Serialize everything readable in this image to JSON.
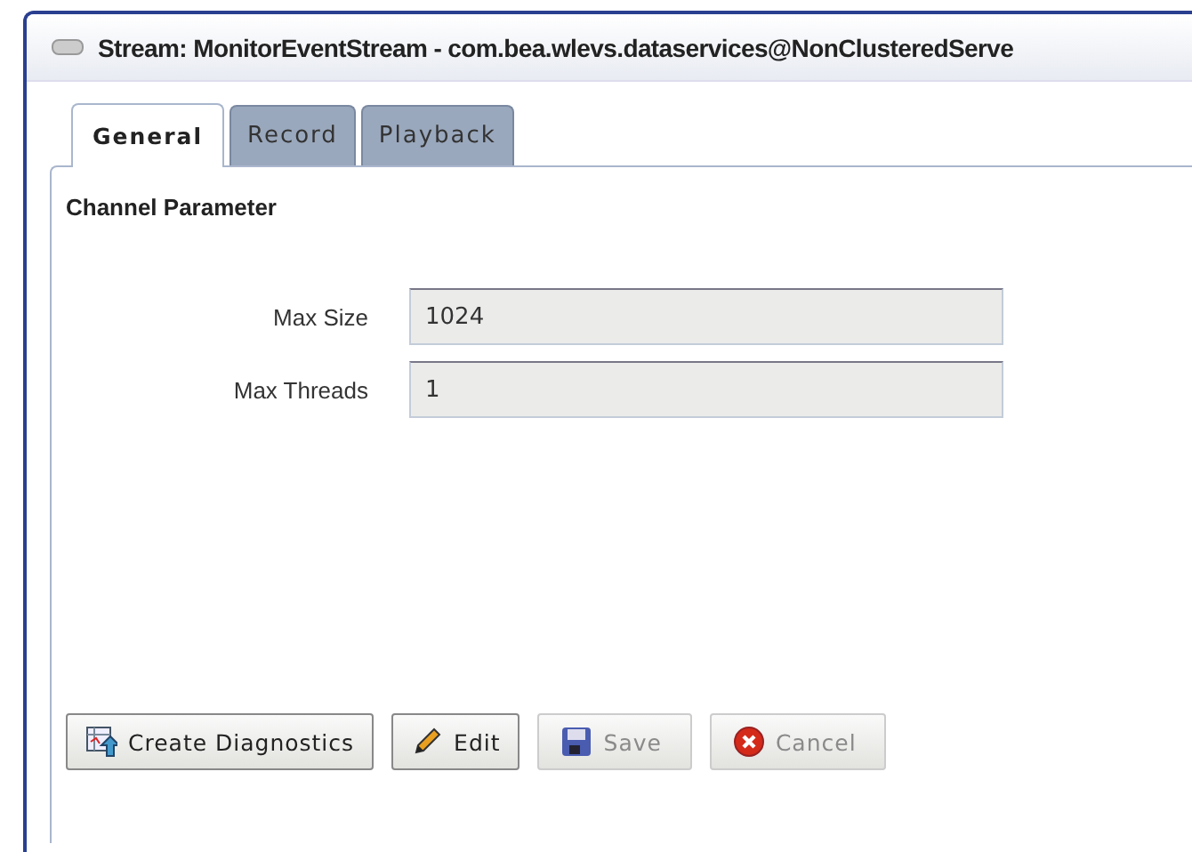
{
  "window": {
    "title": "Stream: MonitorEventStream - com.bea.wlevs.dataservices@NonClusteredServe"
  },
  "tabs": [
    {
      "label": "General",
      "selected": true
    },
    {
      "label": "Record",
      "selected": false
    },
    {
      "label": "Playback",
      "selected": false
    }
  ],
  "section": {
    "title": "Channel Parameter"
  },
  "fields": [
    {
      "label": "Max Size",
      "value": "1024",
      "disabled": true
    },
    {
      "label": "Max Threads",
      "value": "1",
      "disabled": true
    }
  ],
  "buttons": [
    {
      "label": "Create Diagnostics",
      "kind": "diagnostics",
      "disabled": false
    },
    {
      "label": "Edit",
      "kind": "edit",
      "disabled": false
    },
    {
      "label": "Save",
      "kind": "save",
      "disabled": true
    },
    {
      "label": "Cancel",
      "kind": "cancel",
      "disabled": true
    }
  ]
}
